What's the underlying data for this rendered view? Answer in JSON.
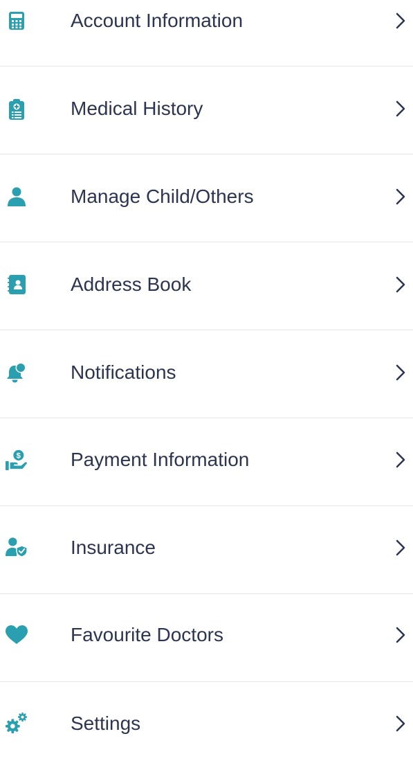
{
  "colors": {
    "accent": "#2a9fb0",
    "text": "#2c3550",
    "divider": "#e6e6e6",
    "chevron": "#2c3550"
  },
  "menu": {
    "items": [
      {
        "label": "Account Information",
        "icon": "calculator-icon"
      },
      {
        "label": "Medical History",
        "icon": "clipboard-medical-icon"
      },
      {
        "label": "Manage Child/Others",
        "icon": "person-icon"
      },
      {
        "label": "Address Book",
        "icon": "contact-book-icon"
      },
      {
        "label": "Notifications",
        "icon": "bell-icon"
      },
      {
        "label": "Payment Information",
        "icon": "hand-payment-icon"
      },
      {
        "label": "Insurance",
        "icon": "user-shield-icon"
      },
      {
        "label": "Favourite Doctors",
        "icon": "heart-icon"
      },
      {
        "label": "Settings",
        "icon": "gears-icon"
      }
    ]
  }
}
